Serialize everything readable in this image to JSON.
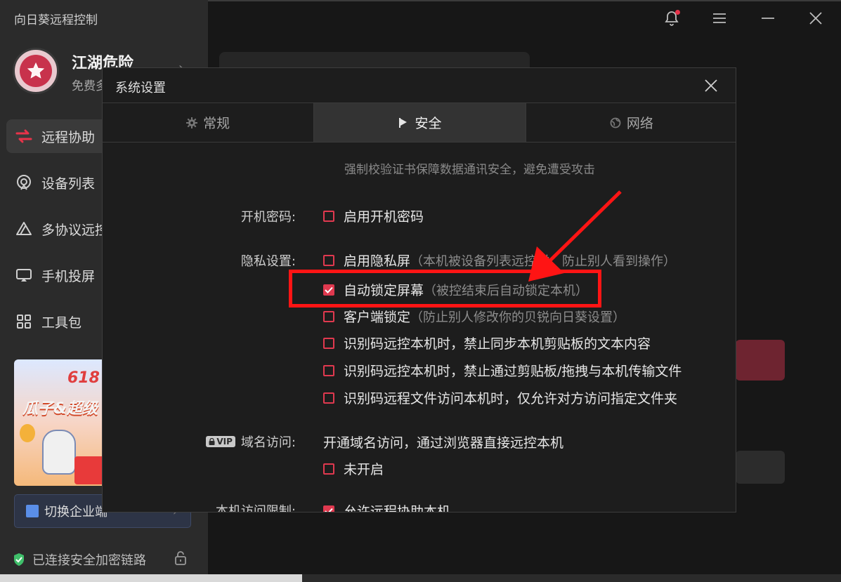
{
  "app": {
    "title": "向日葵远程控制",
    "user_name": "江湖危险",
    "user_plan": "免费多"
  },
  "sidebar": {
    "items": [
      {
        "label": "远程协助",
        "icon": "swap-arrows-icon",
        "active": true
      },
      {
        "label": "设备列表",
        "icon": "device-list-icon",
        "active": false
      },
      {
        "label": "多协议远控",
        "icon": "triangle-protocol-icon",
        "active": false
      },
      {
        "label": "手机投屏",
        "icon": "screen-cast-icon",
        "active": false
      },
      {
        "label": "工具包",
        "icon": "grid-toolbox-icon",
        "active": false
      }
    ],
    "promo_line1": "618",
    "promo_line2": "瓜子&超级",
    "switch_label": "切换企业端",
    "status": "已连接安全加密链路"
  },
  "dialog": {
    "title": "系统设置",
    "tabs": [
      {
        "label": "常规",
        "icon": "gear-icon"
      },
      {
        "label": "安全",
        "icon": "flag-icon"
      },
      {
        "label": "网络",
        "icon": "globe-icon"
      }
    ],
    "active_tab": "安全",
    "cut_text": "强制校验证书保障数据通讯安全，避免遭受攻击",
    "boot_password": {
      "label": "开机密码:",
      "option": "启用开机密码",
      "checked": false
    },
    "privacy": {
      "label": "隐私设置:",
      "options": [
        {
          "text": "启用隐私屏",
          "hint": "（本机被设备列表远控时，防止别人看到操作）",
          "checked": false
        },
        {
          "text": "自动锁定屏幕",
          "hint": "（被控结束后自动锁定本机）",
          "checked": true
        },
        {
          "text": "客户端锁定",
          "hint": "（防止别人修改你的贝锐向日葵设置）",
          "checked": false
        },
        {
          "text": "识别码远控本机时，禁止同步本机剪贴板的文本内容",
          "hint": "",
          "checked": false
        },
        {
          "text": "识别码远控本机时，禁止通过剪贴板/拖拽与本机传输文件",
          "hint": "",
          "checked": false
        },
        {
          "text": "识别码远程文件访问本机时，仅允许对方访问指定文件夹",
          "hint": "",
          "checked": false
        }
      ]
    },
    "domain": {
      "badge": "VIP",
      "label": "域名访问:",
      "description": "开通域名访问，通过浏览器直接远控本机",
      "option": "未开启",
      "checked": false
    },
    "access_limit": {
      "label": "本机访问限制:",
      "option": "允许远程协助本机",
      "checked": true
    }
  },
  "colors": {
    "accent": "#e0394f",
    "annotation": "#ff1414",
    "dialog_bg": "#1d1d1d",
    "sidebar_bg": "#2b2b2b"
  }
}
